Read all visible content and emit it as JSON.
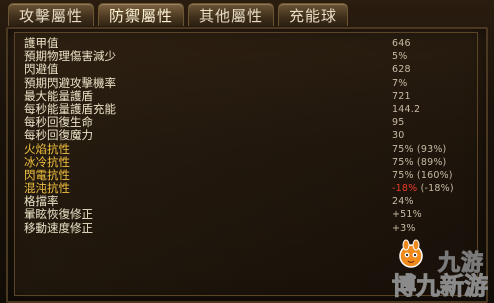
{
  "tabs": [
    {
      "label": "攻擊屬性"
    },
    {
      "label": "防禦屬性"
    },
    {
      "label": "其他屬性"
    },
    {
      "label": "充能球"
    }
  ],
  "rows": [
    {
      "label": "護甲值",
      "value": "646",
      "style": "main"
    },
    {
      "label": "預期物理傷害減少",
      "value": "5%",
      "style": "main"
    },
    {
      "label": "閃避值",
      "value": "628",
      "style": "main"
    },
    {
      "label": "預期閃避攻擊機率",
      "value": "7%",
      "style": "main"
    },
    {
      "label": "最大能量護盾",
      "value": "721",
      "style": "main"
    },
    {
      "label": "每秒能量護盾充能",
      "value": "144.2",
      "style": "main"
    },
    {
      "label": "每秒回復生命",
      "value": "95",
      "style": "main"
    },
    {
      "label": "每秒回復魔力",
      "value": "30",
      "style": "main"
    },
    {
      "label": "火焰抗性",
      "value": "75% (93%)",
      "style": "res"
    },
    {
      "label": "冰冷抗性",
      "value": "75% (89%)",
      "style": "res"
    },
    {
      "label": "閃電抗性",
      "value": "75% (160%)",
      "style": "res"
    },
    {
      "label": "混沌抗性",
      "value_neg": "-18%",
      "value": " (-18%)",
      "style": "res"
    },
    {
      "label": "格擋率",
      "value": "24%",
      "style": "main"
    },
    {
      "label": "暈眩恢復修正",
      "value": "+51%",
      "style": "main"
    },
    {
      "label": "移動速度修正",
      "value": "+3%",
      "style": "main"
    }
  ],
  "watermark": {
    "line1": "九游",
    "line2": "博九新游"
  },
  "colors": {
    "label_main": "#ece4c8",
    "label_resist": "#f0c040",
    "value": "#c7bba4",
    "negative": "#e83a2a"
  }
}
